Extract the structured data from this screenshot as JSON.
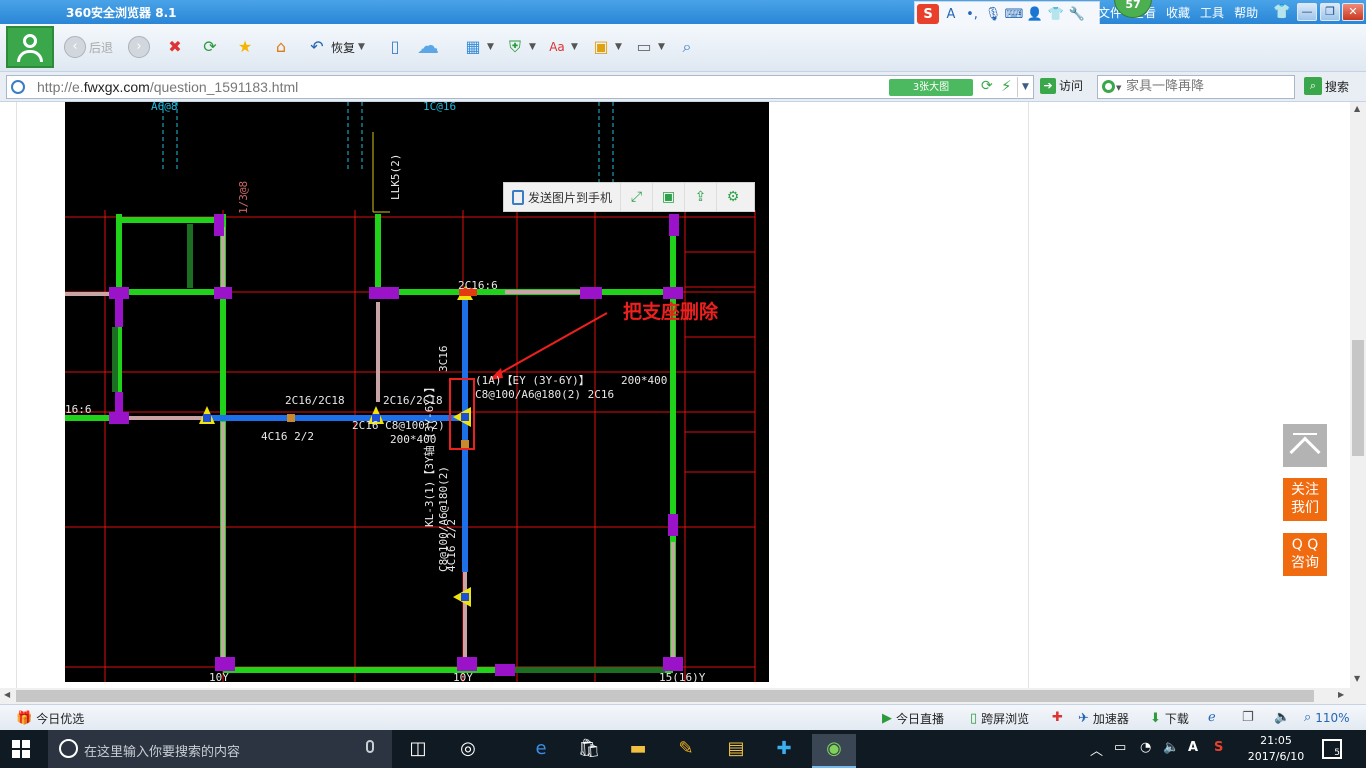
{
  "window": {
    "title": "360安全浏览器 8.1",
    "menu": [
      "文件",
      "查看",
      "收藏",
      "工具",
      "帮助"
    ],
    "notification_count": "57",
    "controls": [
      "—",
      "❐",
      "✕"
    ]
  },
  "ime_bar": {
    "icons": [
      "sogou-icon",
      "font-icon",
      "punctuation-icon",
      "microphone-icon",
      "keyboard-icon",
      "user-icon",
      "shirt-icon",
      "wrench-icon"
    ],
    "sogou_label": "S",
    "font_label": "A"
  },
  "toolbar": {
    "back_label": "后退",
    "restore_label": "恢复",
    "icons": [
      "back-icon",
      "forward-icon",
      "stop-icon",
      "refresh-icon",
      "favorite-star-icon",
      "home-icon",
      "restore-icon",
      "phone-icon",
      "cloud-icon",
      "apps-grid-icon",
      "security-shield-icon",
      "translate-icon",
      "screenshot-icon",
      "game-icon",
      "zoom-search-icon"
    ]
  },
  "address_bar": {
    "url_prefix": "http://e.",
    "url_domain": "fwxgx.com",
    "url_path": "/question_1591183.html",
    "big_image_label": "3张大图",
    "visit_label": "访问",
    "search_placeholder": "家具一降再降",
    "search_label": "搜索"
  },
  "image_toolbar": {
    "send_label": "发送图片到手机",
    "icons": [
      "fullscreen-icon",
      "save-icon",
      "share-icon",
      "settings-icon"
    ]
  },
  "cad_drawing": {
    "annotation": "把支座删除",
    "texts": [
      "2C16:6",
      "2C16/2C18",
      "2C16/2C18",
      "4C16 2/2",
      "2C16 C8@100(2)",
      "200*400",
      "200*400",
      "(1A)【EY (3Y-6Y)】",
      "C8@100/A6@180(2) 2C16",
      "KL-3(1)【3Y轴 (3Y-6Y)】",
      "C8@100/A6@180(2)",
      "4C16 2/2",
      "3C16",
      "LLK5(2)",
      "1/3@8",
      "16:6",
      "1C@16",
      "10Y",
      "10Y",
      "15(16)Y",
      "A6@8"
    ]
  },
  "side_float": {
    "top_label": "返回顶部",
    "follow_label_1": "关注",
    "follow_label_2": "我们",
    "qq_label_1": "Q Q",
    "qq_label_2": "咨询"
  },
  "status_bar": {
    "today_label": "今日优选",
    "live_label": "今日直播",
    "cross_screen_label": "跨屏浏览",
    "accelerator_label": "加速器",
    "download_label": "下载",
    "zoom": "110%"
  },
  "taskbar": {
    "search_placeholder": "在这里输入你要搜索的内容",
    "apps": [
      "task-view-icon",
      "cortana-app-icon",
      "edge-icon",
      "store-icon",
      "file-explorer-icon",
      "notes-icon",
      "sticky-icon",
      "browser-icon",
      "360-browser-icon"
    ],
    "tray_input": "A",
    "time": "21:05",
    "date": "2017/6/10",
    "notification_count": "5"
  }
}
